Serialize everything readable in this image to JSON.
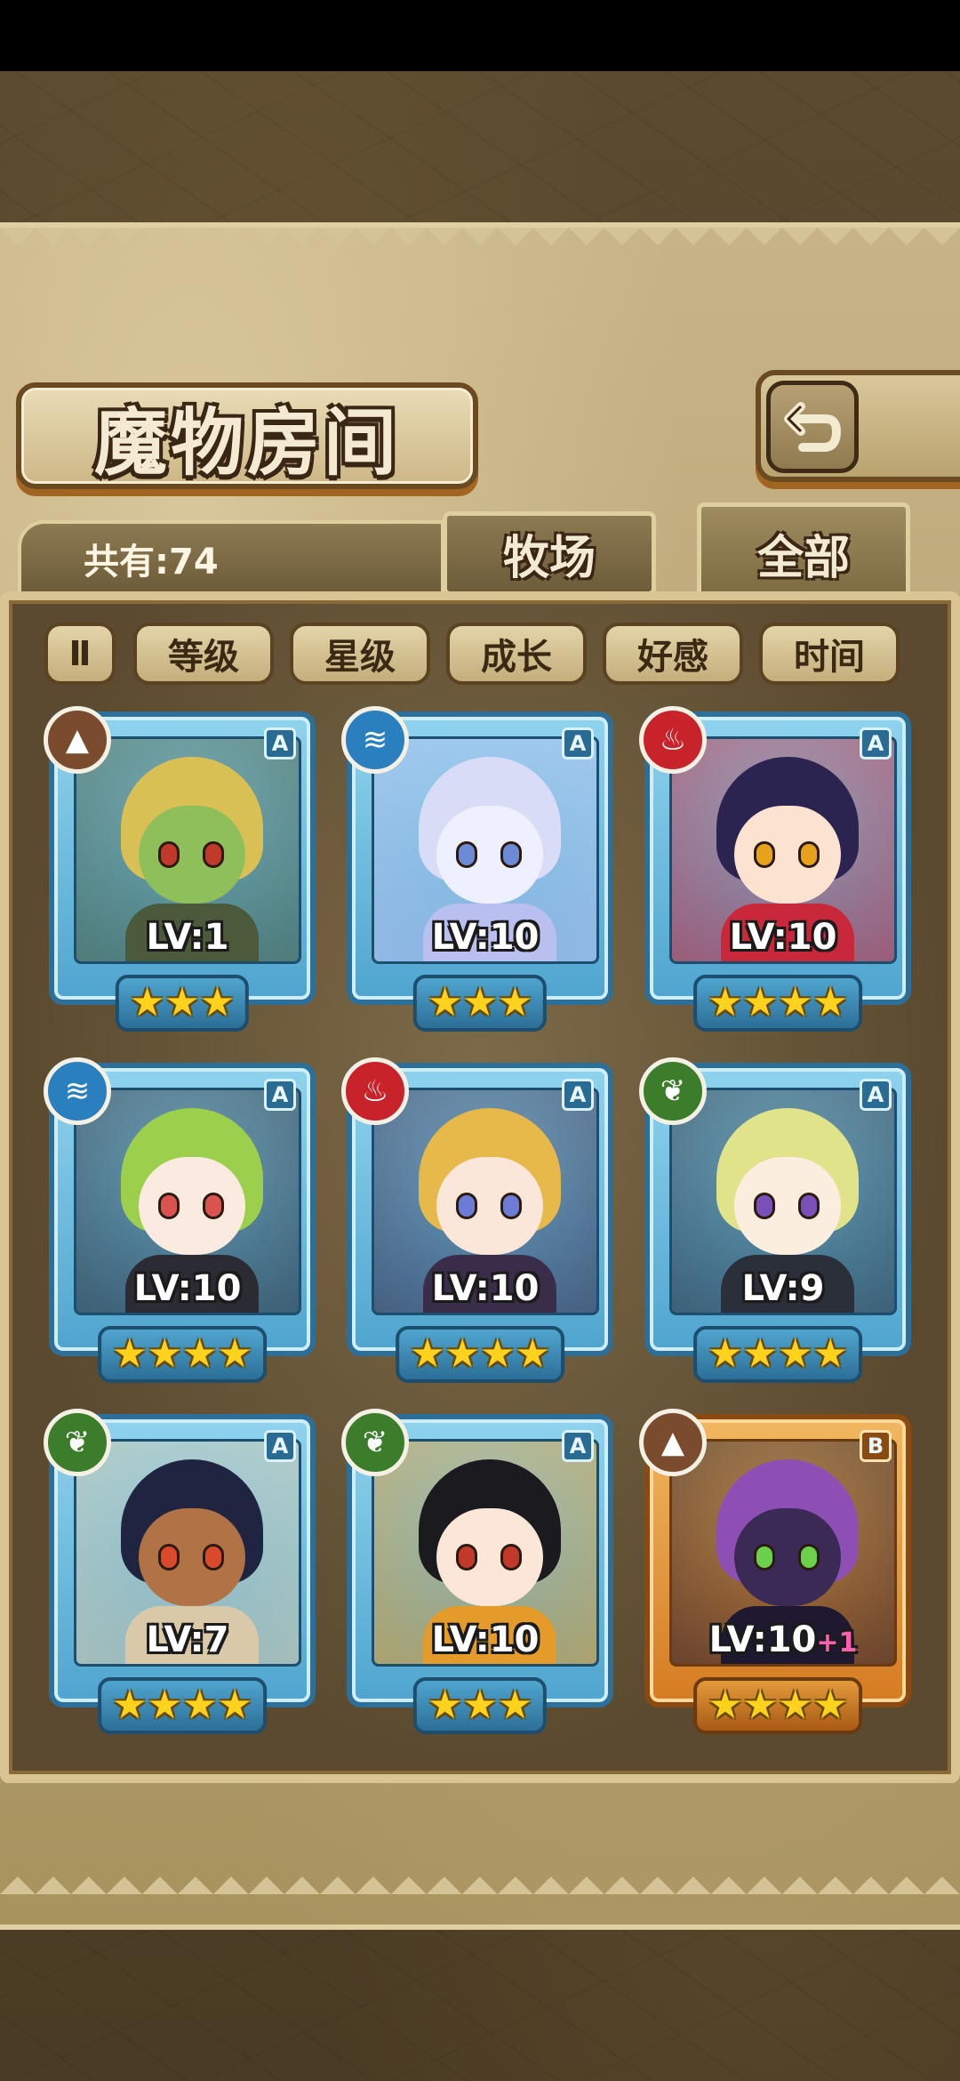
{
  "title": "魔物房间",
  "count_label": "共有:74",
  "tabs": [
    {
      "label": "牧场"
    },
    {
      "label": "全部"
    }
  ],
  "sort_toggle_label": "Ⅱ",
  "sort_buttons": [
    {
      "label": "等级"
    },
    {
      "label": "星级"
    },
    {
      "label": "成长"
    },
    {
      "label": "好感"
    },
    {
      "label": "时间"
    }
  ],
  "cards": [
    {
      "element": "earth",
      "element_icon": "mountain-icon",
      "rank": "A",
      "level": "LV:1",
      "bonus": "",
      "stars": "★★★",
      "hair": "#d9c055",
      "skin": "#8fbf5a",
      "eyes": "#c0392b",
      "outfit": "#4a5a3a"
    },
    {
      "element": "water",
      "element_icon": "water-icon",
      "rank": "A",
      "level": "LV:10",
      "bonus": "",
      "stars": "★★★",
      "hair": "#d9dcf6",
      "skin": "#eef0ff",
      "eyes": "#6c8ad6",
      "outfit": "#b9c0ef"
    },
    {
      "element": "fire",
      "element_icon": "flame-icon",
      "rank": "A",
      "level": "LV:10",
      "bonus": "",
      "stars": "★★★★",
      "hair": "#2b2450",
      "skin": "#fbe3d0",
      "eyes": "#e6a21a",
      "outfit": "#c9283a"
    },
    {
      "element": "water",
      "element_icon": "water-icon",
      "rank": "A",
      "level": "LV:10",
      "bonus": "",
      "stars": "★★★★",
      "hair": "#9ccf4c",
      "skin": "#fbeadf",
      "eyes": "#d9534f",
      "outfit": "#2b2b33"
    },
    {
      "element": "fire",
      "element_icon": "flame-icon",
      "rank": "A",
      "level": "LV:10",
      "bonus": "",
      "stars": "★★★★",
      "hair": "#e7b84a",
      "skin": "#fbe6da",
      "eyes": "#6b7bd6",
      "outfit": "#3a2d4a"
    },
    {
      "element": "wood",
      "element_icon": "leaf-icon",
      "rank": "A",
      "level": "LV:9",
      "bonus": "",
      "stars": "★★★★",
      "hair": "#e1e38a",
      "skin": "#fbeede",
      "eyes": "#7a4fb7",
      "outfit": "#2a2f3a"
    },
    {
      "element": "wood",
      "element_icon": "leaf-icon",
      "rank": "A",
      "level": "LV:7",
      "bonus": "",
      "stars": "★★★★",
      "hair": "#1f2540",
      "skin": "#b17346",
      "eyes": "#d9492a",
      "outfit": "#d9c9a8"
    },
    {
      "element": "wood",
      "element_icon": "leaf-icon",
      "rank": "A",
      "level": "LV:10",
      "bonus": "",
      "stars": "★★★",
      "hair": "#1a1a1f",
      "skin": "#fbe6d8",
      "eyes": "#c0392b",
      "outfit": "#e49b2a"
    },
    {
      "element": "earth",
      "element_icon": "mountain-icon",
      "rank": "B",
      "level": "LV:10",
      "bonus": "+1",
      "stars": "★★★★",
      "hair": "#8d4fb4",
      "skin": "#3b2a55",
      "eyes": "#6bd14b",
      "outfit": "#1e1830"
    }
  ]
}
